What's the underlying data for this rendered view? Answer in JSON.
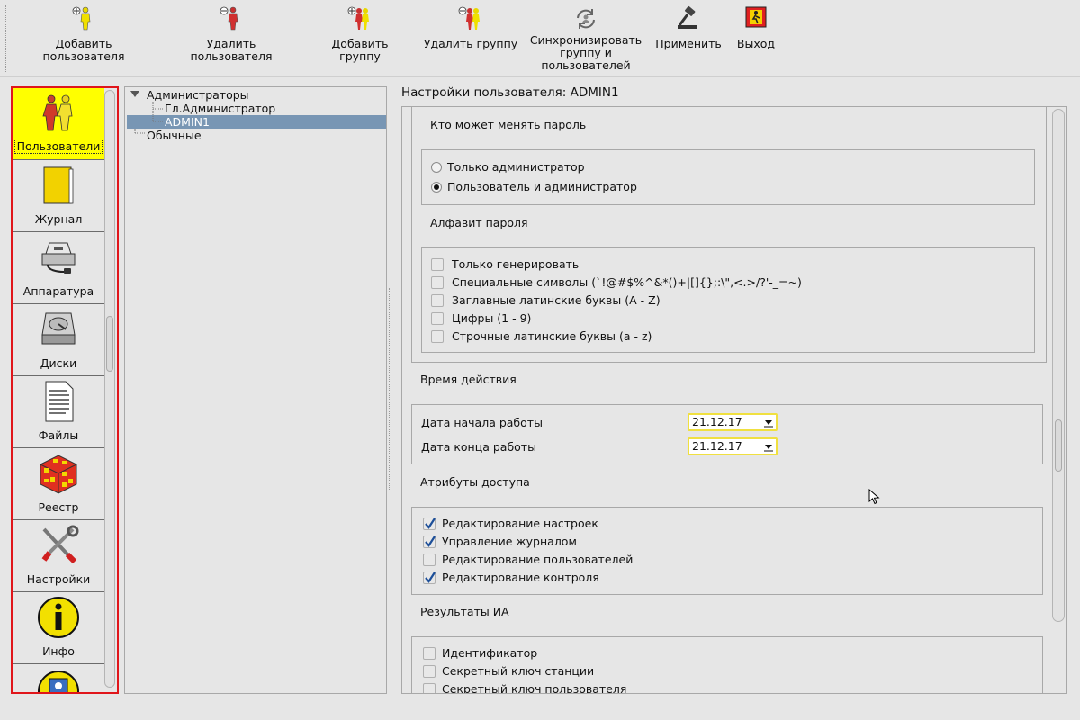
{
  "toolbar": {
    "add_user": "Добавить пользователя",
    "delete_user": "Удалить пользователя",
    "add_group": "Добавить группу",
    "delete_group": "Удалить группу",
    "sync_line1": "Синхронизировать",
    "sync_line2": "группу и",
    "sync_line3": "пользователей",
    "apply": "Применить",
    "exit": "Выход"
  },
  "nav": {
    "users": "Пользователи",
    "journal": "Журнал",
    "hardware": "Аппаратура",
    "disks": "Диски",
    "files": "Файлы",
    "registry": "Реестр",
    "settings": "Настройки",
    "info": "Инфо"
  },
  "tree": {
    "admins": "Администраторы",
    "chief_admin": "Гл.Администратор",
    "admin1": "ADMIN1",
    "regular": "Обычные"
  },
  "panel": {
    "title": "Настройки пользователя: ADMIN1",
    "who_changes_password": "Кто может менять пароль",
    "radio_admin_only": "Только администратор",
    "radio_user_and_admin": "Пользователь и администратор",
    "password_alphabet": "Алфавит пароля",
    "alphabet": {
      "generate_only": "Только генерировать",
      "special": "Специальные символы (`!@#$%^&*()+|[]{};:\\\",<.>/?'-_=~)",
      "upper_latin": "Заглавные латинские буквы (A - Z)",
      "digits": "Цифры (1 - 9)",
      "lower_latin": "Строчные латинские буквы (a - z)"
    },
    "validity": "Время действия",
    "start_date_label": "Дата начала работы",
    "start_date_value": "21.12.17",
    "end_date_label": "Дата конца работы",
    "end_date_value": "21.12.17",
    "access_attributes": "Атрибуты доступа",
    "access": {
      "edit_settings": "Редактирование настроек",
      "manage_journal": "Управление журналом",
      "edit_users": "Редактирование пользователей",
      "edit_control": "Редактирование контроля"
    },
    "ia_results": "Результаты ИА",
    "ia": {
      "identifier": "Идентификатор",
      "station_key": "Секретный ключ станции",
      "user_key": "Секретный ключ пользователя"
    }
  },
  "state": {
    "radio_selected": "user_and_admin",
    "checked_access": [
      "edit_settings",
      "manage_journal",
      "edit_control"
    ]
  },
  "colors": {
    "selection": "#7896b4",
    "active_nav": "#ffff00",
    "nav_border": "#e0161b",
    "date_border": "#f0e040"
  }
}
